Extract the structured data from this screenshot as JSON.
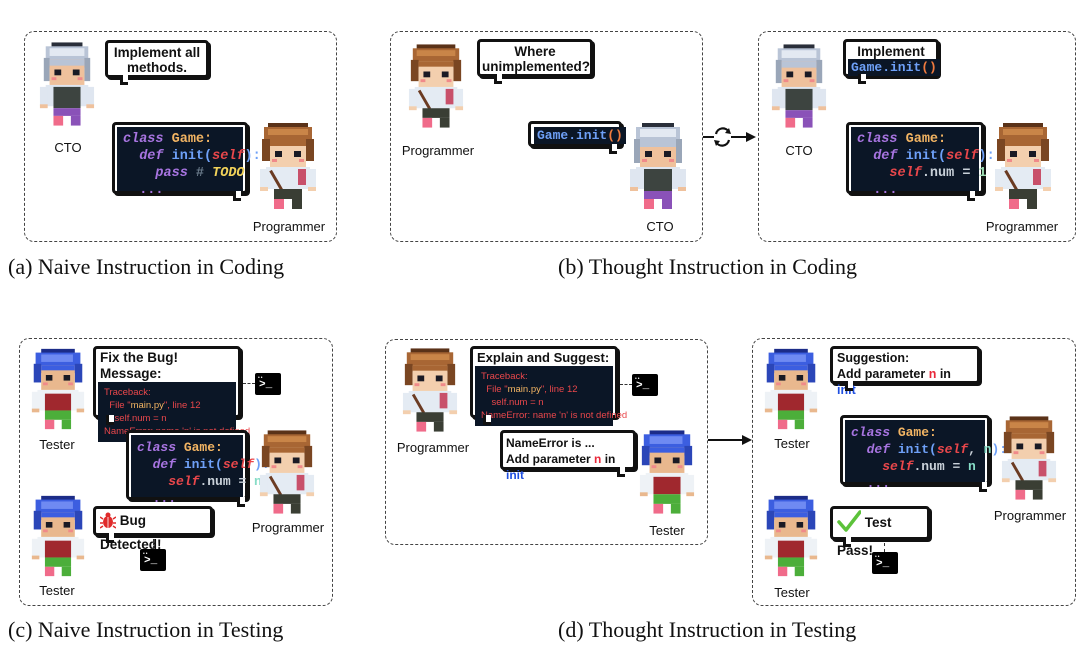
{
  "panels": {
    "a": {
      "caption": "(a)  Naive Instruction in Coding",
      "cto_bubble": [
        "Implement all",
        "methods."
      ],
      "cto_label": "CTO",
      "programmer_label": "Programmer",
      "code": {
        "line1_kw": "class",
        "line1_name": " Game",
        "line1_colon": ":",
        "line2_kw": "def",
        "line2_fn": " init",
        "line2_open": "(",
        "line2_self": "self",
        "line2_close": "):",
        "line3_pass": "pass",
        "line3_hash": " # ",
        "line3_todo": "TODO",
        "line4": "..."
      }
    },
    "b": {
      "caption": "(b)  Thought Instruction in Coding",
      "programmer_bubble": [
        "Where",
        "unimplemented?"
      ],
      "programmer_label": "Programmer",
      "cto_code_bubble": "Game.init",
      "cto_code_paren": "()",
      "cto_label": "CTO",
      "cto2_bubble_title": "Implement",
      "cto2_code": "Game.init",
      "cto2_paren": "()",
      "cto2_label": "CTO",
      "programmer2_label": "Programmer",
      "code": {
        "line1_kw": "class",
        "line1_name": " Game",
        "line1_colon": ":",
        "line2_kw": "def",
        "line2_fn": " init",
        "line2_open": "(",
        "line2_self": "self",
        "line2_close": "):",
        "line3_self": "self",
        "line3_rest": ".num = ",
        "line3_val": "1",
        "line4": "..."
      },
      "loop_icon": "refresh-loop-icon"
    },
    "c": {
      "caption": "(c)  Naive Instruction in Testing",
      "tester_bubble_title": "Fix the Bug! Message:",
      "traceback": {
        "l1": "Traceback:",
        "l2_a": "  File \"",
        "l2_file": "main.py",
        "l2_b": "\", line 12",
        "l3": "    self.num = n",
        "l4": "NameError: name 'n' is not defined"
      },
      "tester_label": "Tester",
      "tester2_label": "Tester",
      "programmer_label": "Programmer",
      "bug_bubble": "Bug Detected!",
      "code": {
        "line1_kw": "class",
        "line1_name": " Game",
        "line1_colon": ":",
        "line2_kw": "def",
        "line2_fn": " init",
        "line2_open": "(",
        "line2_self": "self",
        "line2_close": "):",
        "line3_self": "self",
        "line3_rest": ".num = ",
        "line3_val": "n",
        "line4": "..."
      }
    },
    "d": {
      "caption": "(d)  Thought Instruction in Testing",
      "programmer_bubble_title": "Explain and Suggest:",
      "traceback": {
        "l1": "Traceback:",
        "l2_a": "  File \"",
        "l2_file": "main.py",
        "l2_b": "\", line 12",
        "l3": "    self.num = n",
        "l4": "NameError: name 'n' is not defined"
      },
      "programmer_label": "Programmer",
      "tester_reply_l1": "NameError is ...",
      "tester_reply_l2a": "Add parameter ",
      "tester_reply_n": "n",
      "tester_reply_in": " in ",
      "tester_reply_init": "init",
      "tester_label": "Tester",
      "suggestion_title": "Suggestion:",
      "suggestion_l2a": "Add parameter ",
      "suggestion_n": "n",
      "suggestion_in": " in ",
      "suggestion_init": "init",
      "tester2_label": "Tester",
      "tester3_label": "Tester",
      "programmer2_label": "Programmer",
      "pass_bubble": "Test Pass!",
      "code": {
        "line1_kw": "class",
        "line1_name": " Game",
        "line1_colon": ":",
        "line2_kw": "def",
        "line2_fn": " init",
        "line2_open": "(",
        "line2_self": "self",
        "line2_comma": ", ",
        "line2_n": "n",
        "line2_close": "):",
        "line3_self": "self",
        "line3_rest": ".num = ",
        "line3_val": "n",
        "line4": "..."
      }
    }
  },
  "colors": {
    "code_bg": "#0b1626",
    "keyword": "#a774e0",
    "class_name": "#f2b463",
    "function": "#6ea0f7",
    "self": "#e9474b",
    "error_text": "#e9474b",
    "highlight_red": "#e9283a",
    "highlight_blue": "#1f4fe0",
    "check_green": "#5cc23a",
    "bug_red": "#e02a2a"
  },
  "terminal_prompt": ">_"
}
